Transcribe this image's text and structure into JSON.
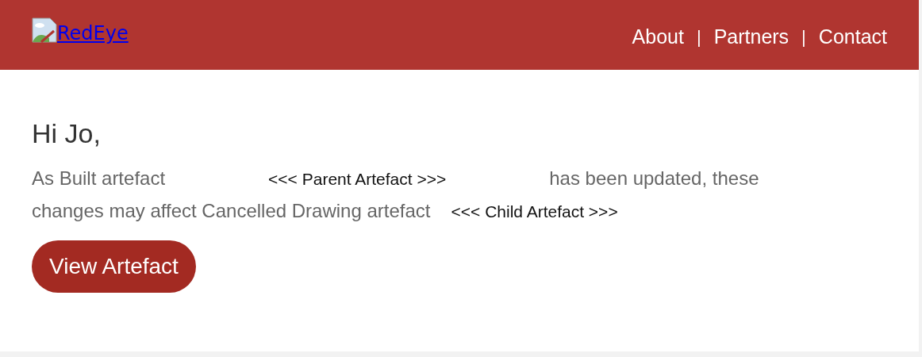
{
  "header": {
    "logo_text": "RedEye",
    "nav": [
      {
        "label": "About"
      },
      {
        "label": "Partners"
      },
      {
        "label": "Contact"
      }
    ],
    "separator": "|"
  },
  "greeting": "Hi Jo,",
  "message_lines": [
    [
      {
        "kind": "text",
        "text": "As Built artefact"
      },
      {
        "kind": "placeholder",
        "text": "<<< Parent Artefact >>>"
      },
      {
        "kind": "text",
        "text": "has been updated, these"
      }
    ],
    [
      {
        "kind": "text",
        "text": "changes may affect Cancelled Drawing artefact"
      },
      {
        "kind": "placeholder",
        "text": "<<< Child Artefact >>>"
      }
    ]
  ],
  "button": "View Artefact"
}
